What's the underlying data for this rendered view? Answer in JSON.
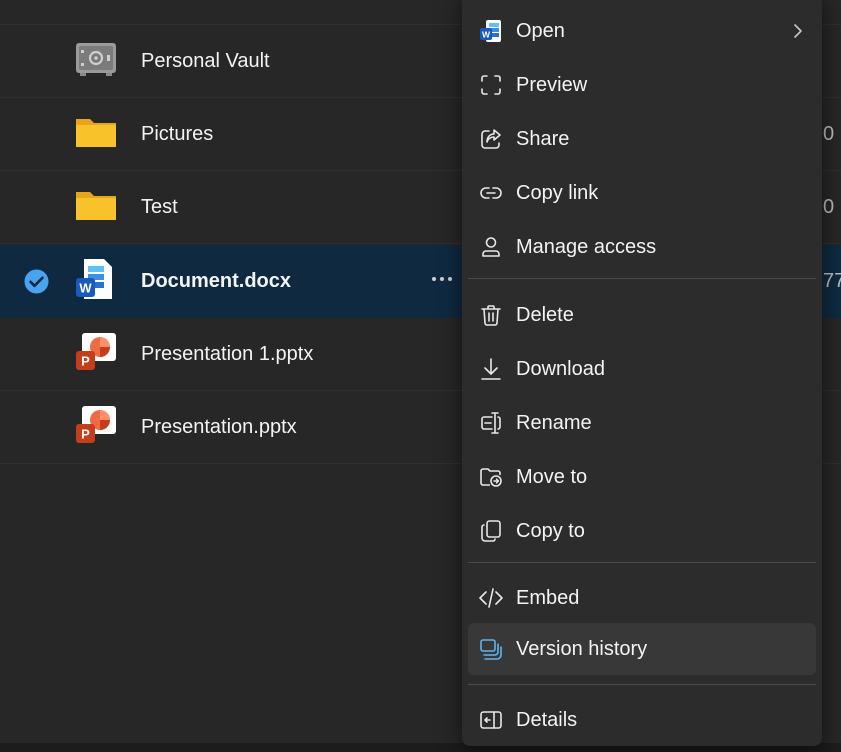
{
  "files": [
    {
      "name": "Personal Vault",
      "icon": "vault-icon",
      "trail": ""
    },
    {
      "name": "Pictures",
      "icon": "folder-icon",
      "trail": "0"
    },
    {
      "name": "Test",
      "icon": "folder-icon",
      "trail": "0"
    },
    {
      "name": "Document.docx",
      "icon": "word-file-icon",
      "trail": "77",
      "selected": true
    },
    {
      "name": "Presentation 1.pptx",
      "icon": "powerpoint-file-icon",
      "trail": ""
    },
    {
      "name": "Presentation.pptx",
      "icon": "powerpoint-file-icon",
      "trail": ""
    }
  ],
  "menu": {
    "items": [
      {
        "label": "Open",
        "icon": "word-app-icon",
        "submenu": true
      },
      {
        "label": "Preview",
        "icon": "preview-icon"
      },
      {
        "label": "Share",
        "icon": "share-icon"
      },
      {
        "label": "Copy link",
        "icon": "link-icon"
      },
      {
        "label": "Manage access",
        "icon": "person-icon"
      },
      {
        "label": "Delete",
        "icon": "trash-icon"
      },
      {
        "label": "Download",
        "icon": "download-icon"
      },
      {
        "label": "Rename",
        "icon": "rename-icon"
      },
      {
        "label": "Move to",
        "icon": "folder-move-icon"
      },
      {
        "label": "Copy to",
        "icon": "copy-icon"
      },
      {
        "label": "Embed",
        "icon": "code-icon"
      },
      {
        "label": "Version history",
        "icon": "history-icon",
        "highlighted": true
      },
      {
        "label": "Details",
        "icon": "details-icon"
      }
    ]
  },
  "colors": {
    "background": "#272727",
    "selected_row": "#0f2a40",
    "menu_background": "#2c2c2c",
    "menu_hover": "#383838",
    "folder": "#f8c22a",
    "accent": "#4aa3f0",
    "word_blue": "#185abd",
    "powerpoint_red": "#c43e1c"
  }
}
